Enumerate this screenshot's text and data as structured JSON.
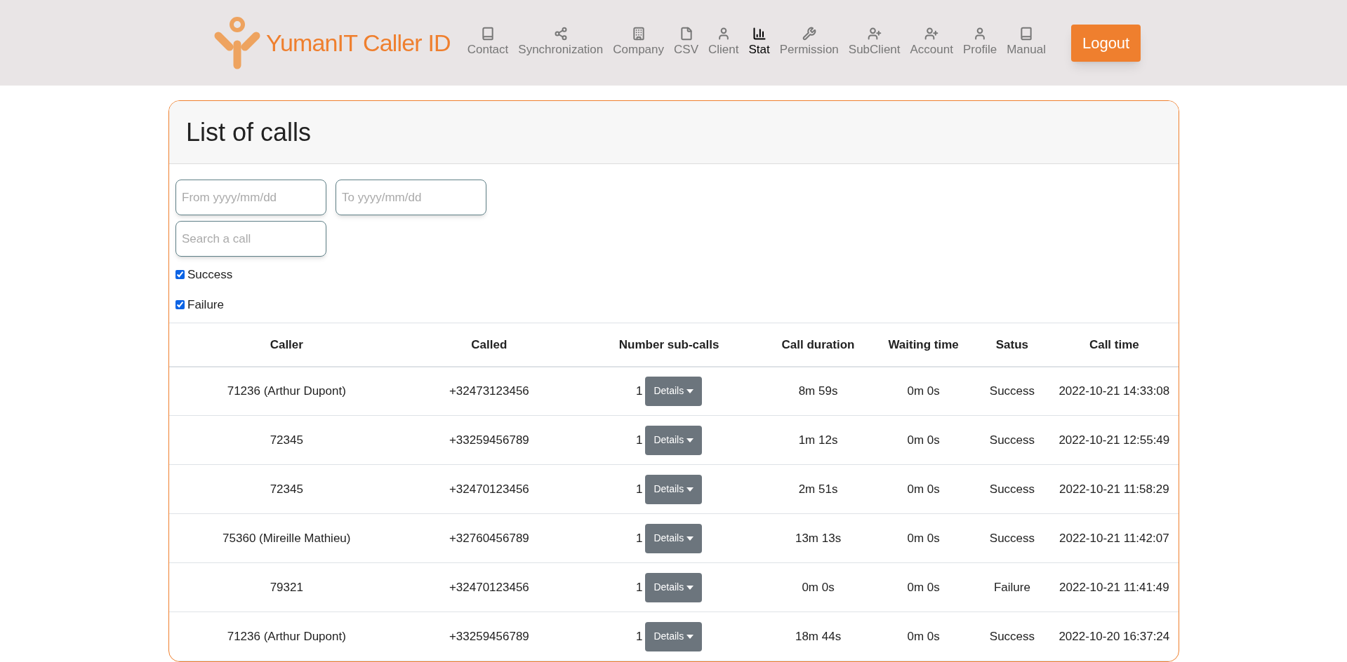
{
  "brand": "YumanIT Caller ID",
  "nav": [
    {
      "label": "Contact",
      "selected": false
    },
    {
      "label": "Synchronization",
      "selected": false
    },
    {
      "label": "Company",
      "selected": false
    },
    {
      "label": "CSV",
      "selected": false
    },
    {
      "label": "Client",
      "selected": false
    },
    {
      "label": "Stat",
      "selected": true
    },
    {
      "label": "Permission",
      "selected": false
    },
    {
      "label": "SubClient",
      "selected": false
    },
    {
      "label": "Account",
      "selected": false
    },
    {
      "label": "Profile",
      "selected": false
    },
    {
      "label": "Manual",
      "selected": false
    }
  ],
  "logout": "Logout",
  "card": {
    "title": "List of calls",
    "from": {
      "placeholder": "From yyyy/mm/dd"
    },
    "to": {
      "placeholder": "To yyyy/mm/dd"
    },
    "search": {
      "placeholder": "Search a call"
    },
    "filters": [
      {
        "label": "Success",
        "checked": true
      },
      {
        "label": "Failure",
        "checked": true
      }
    ],
    "table": {
      "columns": [
        "Caller",
        "Called",
        "Number sub-calls",
        "Call duration",
        "Waiting time",
        "Satus",
        "Call time"
      ],
      "rows": [
        {
          "caller": "71236 (Arthur Dupont)",
          "called": "+32473123456",
          "subcalls": "1",
          "details": "Details",
          "duration": "8m 59s",
          "waiting": "0m 0s",
          "status": "Success",
          "time": "2022-10-21 14:33:08"
        },
        {
          "caller": "72345",
          "called": "+33259456789",
          "subcalls": "1",
          "details": "Details",
          "duration": "1m 12s",
          "waiting": "0m 0s",
          "status": "Success",
          "time": "2022-10-21 12:55:49"
        },
        {
          "caller": "72345",
          "called": "+32470123456",
          "subcalls": "1",
          "details": "Details",
          "duration": "2m 51s",
          "waiting": "0m 0s",
          "status": "Success",
          "time": "2022-10-21 11:58:29"
        },
        {
          "caller": "75360 (Mireille Mathieu)",
          "called": "+32760456789",
          "subcalls": "1",
          "details": "Details",
          "duration": "13m 13s",
          "waiting": "0m 0s",
          "status": "Success",
          "time": "2022-10-21 11:42:07"
        },
        {
          "caller": "79321",
          "called": "+32470123456",
          "subcalls": "1",
          "details": "Details",
          "duration": "0m 0s",
          "waiting": "0m 0s",
          "status": "Failure",
          "time": "2022-10-21 11:41:49"
        },
        {
          "caller": "71236 (Arthur Dupont)",
          "called": "+33259456789",
          "subcalls": "1",
          "details": "Details",
          "duration": "18m 44s",
          "waiting": "0m 0s",
          "status": "Success",
          "time": "2022-10-20 16:37:24"
        }
      ]
    }
  }
}
